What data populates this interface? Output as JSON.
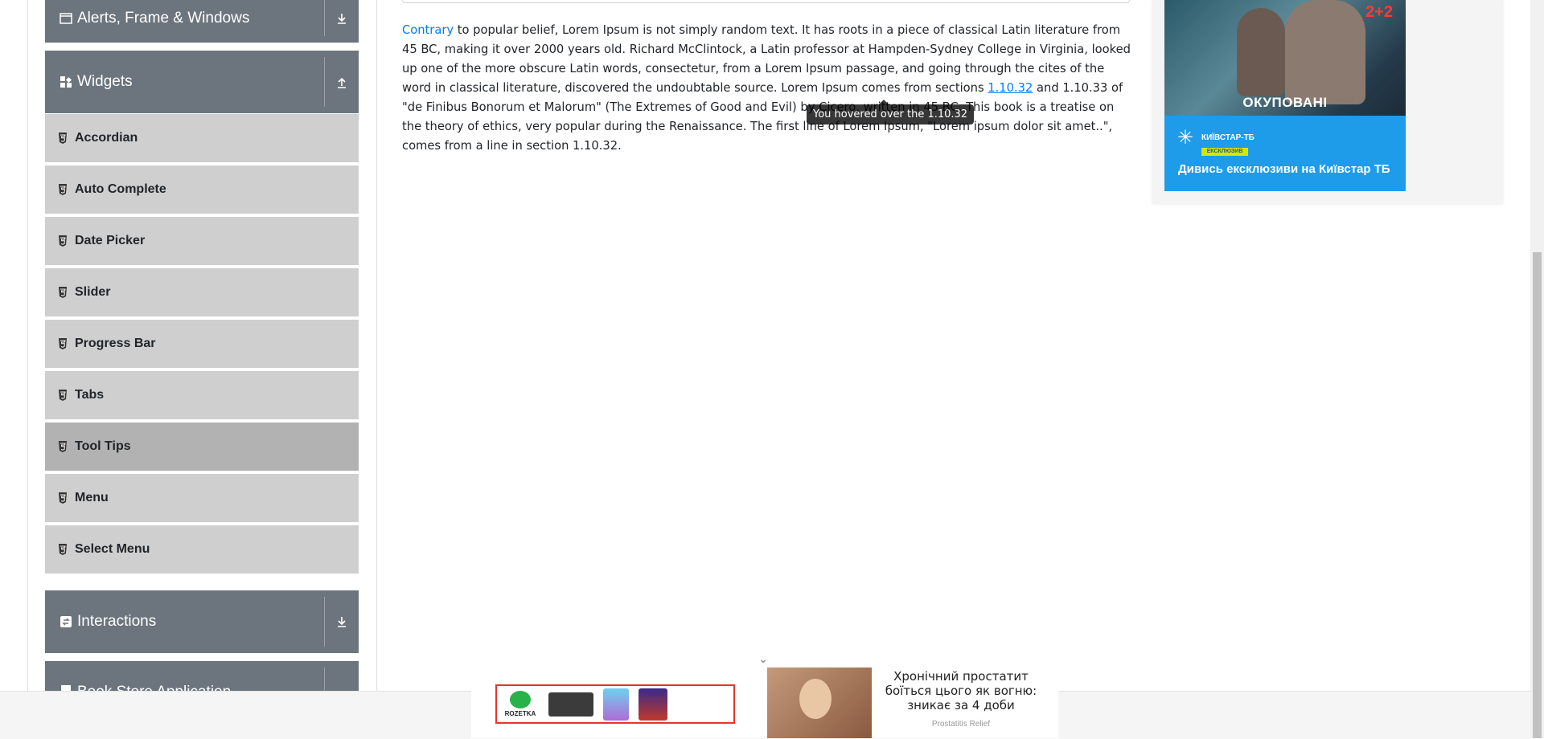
{
  "sidebar": {
    "groups": [
      {
        "label": "Alerts, Frame & Windows",
        "icon": "window-icon",
        "expanded": false
      },
      {
        "label": "Widgets",
        "icon": "widgets-icon",
        "expanded": true
      },
      {
        "label": "Interactions",
        "icon": "interactions-icon",
        "expanded": false
      },
      {
        "label": "Book Store Application",
        "icon": "book-icon",
        "expanded": false
      }
    ],
    "widget_items": [
      {
        "label": "Accordian",
        "active": false
      },
      {
        "label": "Auto Complete",
        "active": false
      },
      {
        "label": "Date Picker",
        "active": false
      },
      {
        "label": "Slider",
        "active": false
      },
      {
        "label": "Progress Bar",
        "active": false
      },
      {
        "label": "Tabs",
        "active": false
      },
      {
        "label": "Tool Tips",
        "active": true
      },
      {
        "label": "Menu",
        "active": false
      },
      {
        "label": "Select Menu",
        "active": false
      }
    ]
  },
  "content": {
    "lead_link": "Contrary",
    "text_part1": " to popular belief, Lorem Ipsum is not simply random text. It has roots in a piece of classical Latin literature from 45 BC, making it over 2000 years old. Richard McClintock, a Latin professor at Hampden-Sydney College in Virginia, looked up one of the more obscure Latin words, consectetur, from a Lorem Ipsum passage, and going through the cites of the word in classical literature, discovered the undoubtable source. Lorem Ipsum comes from sections ",
    "section_link": "1.10.32",
    "text_part2": " and 1.10.33 of \"de Finibus Bonorum et Malorum\" (The Extremes of Good and Evil) by Cicero, written in 45 BC. This book is a treatise on the theory of ethics, very popular during the Renaissance. The first line of Lorem Ipsum, \"Lorem ipsum dolor sit amet..\", comes from a line in section 1.10.32.",
    "tooltip": "You hovered over the 1.10.32"
  },
  "ads": {
    "right": {
      "logo": "2+2",
      "caption": "ОКУПОВАНІ",
      "brand": "КИЇВСТАР-ТБ",
      "badge": "ЕКСКЛЮЗИВ",
      "tagline": "Дивись ексклюзиви на Київстар ТБ"
    },
    "bottom": {
      "rozetka_label": "ROZETKA",
      "headline": "Хронічний простатит боїться цього як вогню: зникає за 4 доби",
      "source": "Prostatitis Relief"
    }
  },
  "colors": {
    "group_header": "#6c757d",
    "menu_item": "#cfcfcf",
    "menu_item_active": "#b2b2b2",
    "link": "#007bff"
  }
}
